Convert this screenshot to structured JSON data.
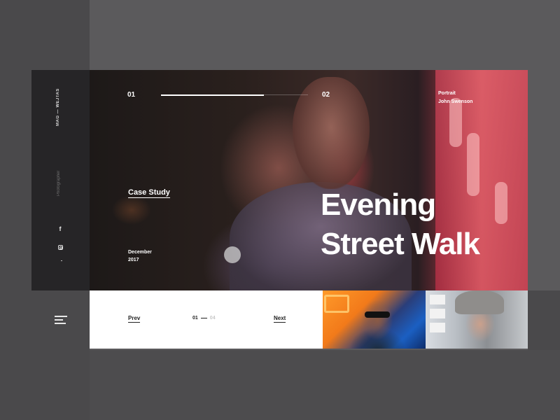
{
  "brand": {
    "name": "MAG — WEJTAS"
  },
  "sidebar": {
    "category": "Photographer",
    "social": [
      {
        "name": "facebook",
        "label": "f"
      },
      {
        "name": "instagram",
        "label": ""
      }
    ]
  },
  "slider": {
    "current": "01",
    "next": "02",
    "progress": 0.7
  },
  "portrait": {
    "label": "Portrait",
    "author": "John Swenson"
  },
  "hero": {
    "case_study": "Case Study",
    "date_line1": "December",
    "date_line2": "2017",
    "headline_line1": "Evening",
    "headline_line2": "Street Walk"
  },
  "nav": {
    "prev_label": "Prev",
    "next_label": "Next",
    "page_current": "01",
    "page_total": "04"
  },
  "colors": {
    "accent_pink": "#c4454d",
    "dark_panel": "#262527",
    "background": "#5b5a5c"
  },
  "icons": {
    "menu": "hamburger-icon",
    "facebook": "facebook-icon",
    "instagram": "instagram-icon"
  }
}
